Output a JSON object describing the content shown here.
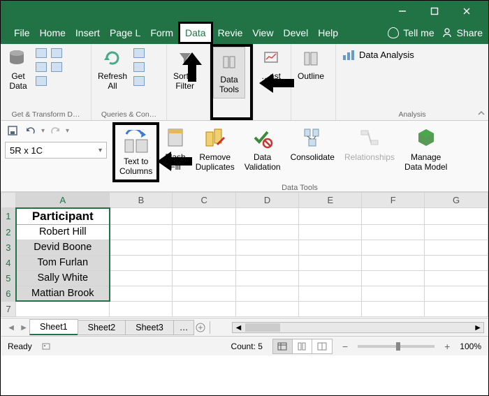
{
  "titlebar": {
    "minimize": "—",
    "maximize": "▢",
    "close": "✕"
  },
  "tabs": [
    "File",
    "Home",
    "Insert",
    "Page L",
    "Form",
    "Data",
    "Revie",
    "View",
    "Devel",
    "Help"
  ],
  "activeTab": "Data",
  "tellme": "Tell me",
  "share": "Share",
  "ribbon": {
    "getdata_group": "Get & Transform D…",
    "getdata": "Get\nData",
    "queries_group": "Queries & Con…",
    "refresh": "Refresh\nAll",
    "sortfilter": "Sort &\nFilter",
    "datatools": "Data\nTools",
    "forecast": "…ast",
    "outline": "Outline",
    "analysis": "Analysis",
    "dataanalysis": "Data Analysis"
  },
  "namebox": "5R x 1C",
  "subtools": {
    "label": "Data Tools",
    "text_to_columns": "Text to\nColumns",
    "flash_fill": "Flash\nFill",
    "remove_dup": "Remove\nDuplicates",
    "validation": "Data\nValidation",
    "consolidate": "Consolidate",
    "relationships": "Relationships",
    "data_model": "Manage\nData Model"
  },
  "grid": {
    "columns": [
      "A",
      "B",
      "C",
      "D",
      "E",
      "F",
      "G"
    ],
    "rows": [
      1,
      2,
      3,
      4,
      5,
      6,
      7
    ],
    "data": {
      "A1": "Participant",
      "A2": "Robert Hill",
      "A3": "Devid Boone",
      "A4": "Tom Furlan",
      "A5": "Sally White",
      "A6": "Mattian Brook"
    }
  },
  "sheets": {
    "active": "Sheet1",
    "list": [
      "Sheet1",
      "Sheet2",
      "Sheet3"
    ],
    "more": "…"
  },
  "status": {
    "ready": "Ready",
    "count": "Count: 5",
    "zoom": "100%"
  }
}
